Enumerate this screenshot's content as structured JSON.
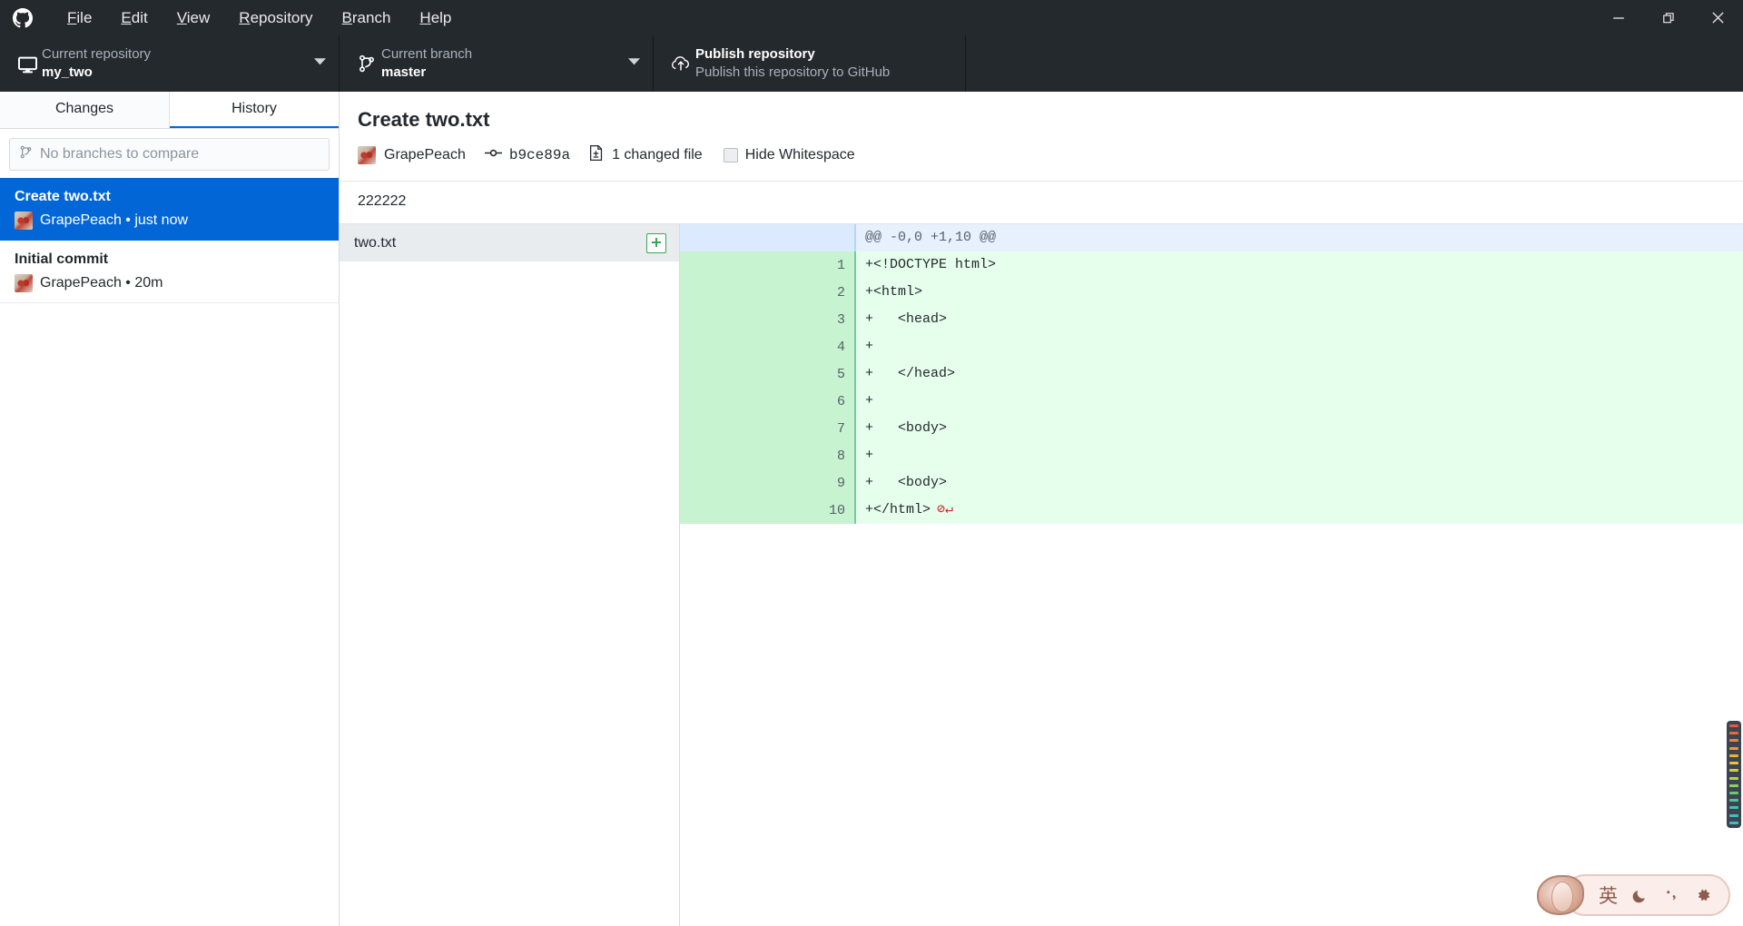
{
  "app": {
    "logo_icon": "github-mark-icon",
    "menu": [
      {
        "label": "File",
        "accel": "F"
      },
      {
        "label": "Edit",
        "accel": "E"
      },
      {
        "label": "View",
        "accel": "V"
      },
      {
        "label": "Repository",
        "accel": "R"
      },
      {
        "label": "Branch",
        "accel": "B"
      },
      {
        "label": "Help",
        "accel": "H"
      }
    ],
    "window_controls": {
      "minimize_icon": "minimize-icon",
      "restore_icon": "restore-icon",
      "close_icon": "close-icon"
    }
  },
  "toolbar": {
    "repository": {
      "icon": "desktop-monitor-icon",
      "label": "Current repository",
      "value": "my_two",
      "caret_icon": "chevron-down-icon"
    },
    "branch": {
      "icon": "git-branch-icon",
      "label": "Current branch",
      "value": "master",
      "caret_icon": "chevron-down-icon"
    },
    "publish": {
      "icon": "cloud-upload-icon",
      "title": "Publish repository",
      "subtitle": "Publish this repository to GitHub"
    }
  },
  "sidebar": {
    "tabs": [
      {
        "label": "Changes",
        "active": false
      },
      {
        "label": "History",
        "active": true
      }
    ],
    "compare": {
      "icon": "git-branch-icon",
      "placeholder": "No branches to compare",
      "value": ""
    },
    "commits": [
      {
        "title": "Create two.txt",
        "author": "GrapePeach",
        "time": "just now",
        "meta": "GrapePeach • just now",
        "selected": true
      },
      {
        "title": "Initial commit",
        "author": "GrapePeach",
        "time": "20m",
        "meta": "GrapePeach • 20m",
        "selected": false
      }
    ]
  },
  "commit_detail": {
    "title": "Create two.txt",
    "author": "GrapePeach",
    "sha": "b9ce89a",
    "sha_icon": "commit-dot-icon",
    "files_icon": "file-diff-icon",
    "changed_files": "1 changed file",
    "hide_whitespace_label": "Hide Whitespace",
    "hide_whitespace_checked": false,
    "description": "222222"
  },
  "file_list": [
    {
      "name": "two.txt",
      "status": "added",
      "status_icon": "plus-icon",
      "selected": true
    }
  ],
  "diff": {
    "hunk_header": "@@ -0,0 +1,10 @@",
    "lines": [
      {
        "num": "1",
        "text": "+<!DOCTYPE html>",
        "type": "add"
      },
      {
        "num": "2",
        "text": "+<html>",
        "type": "add"
      },
      {
        "num": "3",
        "text": "+   <head>",
        "type": "add"
      },
      {
        "num": "4",
        "text": "+",
        "type": "add"
      },
      {
        "num": "5",
        "text": "+   </head>",
        "type": "add"
      },
      {
        "num": "6",
        "text": "+",
        "type": "add"
      },
      {
        "num": "7",
        "text": "+   <body>",
        "type": "add"
      },
      {
        "num": "8",
        "text": "+",
        "type": "add"
      },
      {
        "num": "9",
        "text": "+   <body>",
        "type": "add"
      },
      {
        "num": "10",
        "text": "+</html>",
        "type": "add",
        "no_newline": true
      }
    ]
  },
  "ime": {
    "mode_label": "英",
    "moon_icon": "moon-icon",
    "punctuation_icon": "comma-icon",
    "settings_icon": "gear-icon"
  },
  "colors": {
    "titlebar_bg": "#24292e",
    "accent_blue": "#0366d6",
    "diff_add_bg": "#e6ffec",
    "diff_hunk_bg": "#e7f0fd",
    "added_green": "#34a853",
    "no_newline_red": "#cf222e"
  }
}
